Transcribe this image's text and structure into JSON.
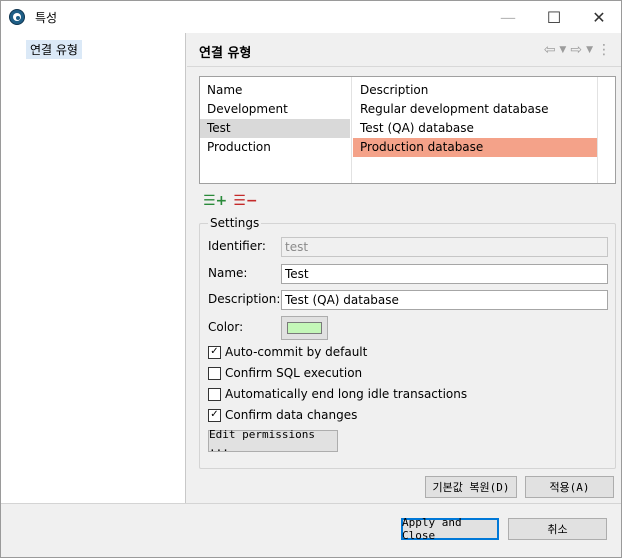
{
  "window": {
    "title": "특성",
    "minimize_glyph": "—",
    "maximize_glyph": "☐",
    "close_glyph": "✕"
  },
  "nav": {
    "items": [
      {
        "label": "연결 유형"
      }
    ]
  },
  "page": {
    "title": "연결 유형",
    "header_icons": [
      "back-arrow-icon",
      "dropdown-icon",
      "forward-arrow-icon",
      "dropdown-icon",
      "more-vertical-icon"
    ]
  },
  "table": {
    "columns": [
      "Name",
      "Description"
    ],
    "rows": [
      {
        "name": "Development",
        "description": "Regular development database"
      },
      {
        "name": "Test",
        "description": "Test (QA) database"
      },
      {
        "name": "Production",
        "description": "Production database"
      }
    ],
    "selected_row": "Test",
    "highlight_color": "#f4a289"
  },
  "toolbar": {
    "add_icon": "add-row-icon",
    "remove_icon": "remove-row-icon"
  },
  "settings": {
    "group_title": "Settings",
    "identifier_label": "Identifier:",
    "identifier_value": "test",
    "name_label": "Name:",
    "name_value": "Test",
    "description_label": "Description:",
    "description_value": "Test (QA) database",
    "color_label": "Color:",
    "color_value": "#c4f7b8",
    "checkboxes": [
      {
        "label": "Auto-commit by default",
        "checked": true
      },
      {
        "label": "Confirm SQL execution",
        "checked": false
      },
      {
        "label": "Automatically end long idle transactions",
        "checked": false
      },
      {
        "label": "Confirm data changes",
        "checked": true
      }
    ],
    "edit_permissions_label": "Edit permissions ..."
  },
  "page_buttons": {
    "restore_defaults": "기본값 복원(D)",
    "apply": "적용(A)"
  },
  "dialog_buttons": {
    "apply_and_close": "Apply and Close",
    "cancel": "취소"
  }
}
